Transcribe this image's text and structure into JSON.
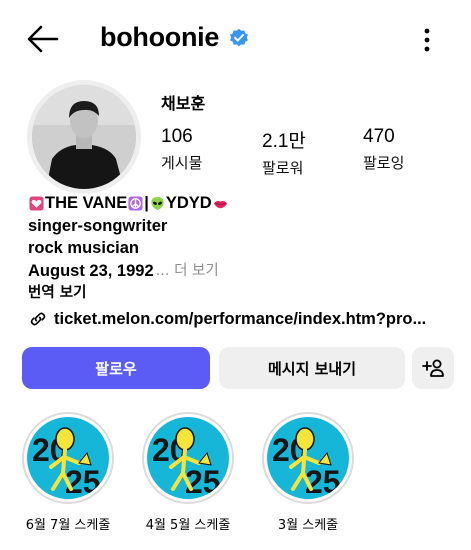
{
  "header": {
    "username": "bohoonie",
    "verified_icon": "verified-badge-icon",
    "back_icon": "back-arrow-icon",
    "more_icon": "more-vertical-icon"
  },
  "profile": {
    "display_name": "채보훈",
    "stats": [
      {
        "value": "106",
        "label": "게시물"
      },
      {
        "value": "2.1만",
        "label": "팔로워"
      },
      {
        "value": "470",
        "label": "팔로잉"
      }
    ],
    "bio": {
      "line1_a": "THE VANE",
      "line1_b": " |",
      "line1_c": "YDYD",
      "line2": "singer-songwriter",
      "line3": "rock musician",
      "line4": "August 23, 1992",
      "line4_more": "... 더 보기",
      "translate": "번역 보기"
    },
    "link": "ticket.melon.com/performance/index.htm?pro..."
  },
  "actions": {
    "follow": "팔로우",
    "message": "메시지 보내기"
  },
  "highlights": [
    {
      "label": "6월 7월 스케줄"
    },
    {
      "label": "4월 5월 스케줄"
    },
    {
      "label": "3월 스케줄"
    }
  ],
  "colors": {
    "accent": "#5b5bf5",
    "verified": "#3897f0",
    "highlight_bg": "#16b6d8",
    "highlight_figure": "#f5e43a"
  }
}
